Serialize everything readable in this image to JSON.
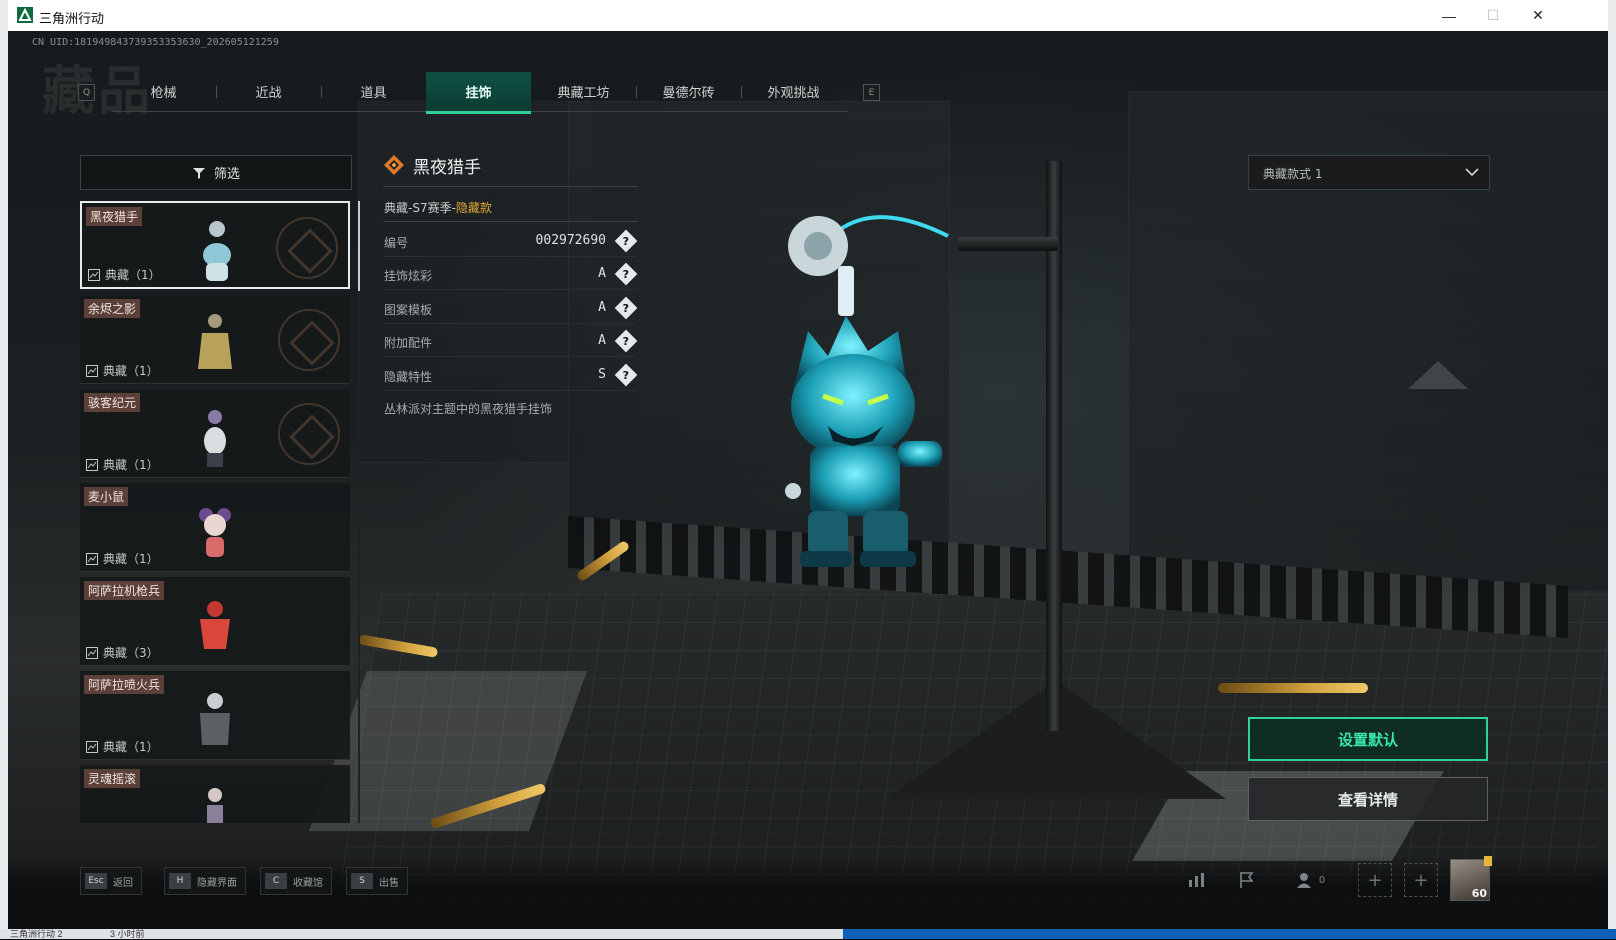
{
  "window": {
    "title": "三角洲行动",
    "controls": {
      "minimize": "—",
      "maximize": "☐",
      "close": "✕"
    }
  },
  "uid_text": "CN UID:18194984373935335363​0_202605121259",
  "bg_heading": "藏品",
  "tabs": {
    "left_key": "Q",
    "right_key": "E",
    "items": [
      {
        "label": "枪械",
        "active": false
      },
      {
        "label": "近战",
        "active": false
      },
      {
        "label": "道具",
        "active": false
      },
      {
        "label": "挂饰",
        "active": true
      },
      {
        "label": "典藏工坊",
        "active": false
      },
      {
        "label": "曼德尔砖",
        "active": false
      },
      {
        "label": "外观挑战",
        "active": false
      }
    ]
  },
  "filter": {
    "label": "筛选",
    "icon": "filter-icon"
  },
  "list": {
    "items": [
      {
        "name": "黑夜猎手",
        "badge": "典藏（1）",
        "selected": true
      },
      {
        "name": "余烬之影",
        "badge": "典藏（1）",
        "selected": false
      },
      {
        "name": "骇客纪元",
        "badge": "典藏（1）",
        "selected": false
      },
      {
        "name": "麦小鼠",
        "badge": "典藏（1）",
        "selected": false
      },
      {
        "name": "阿萨拉机枪兵",
        "badge": "典藏（3）",
        "selected": false
      },
      {
        "name": "阿萨拉喷火兵",
        "badge": "典藏（1）",
        "selected": false
      },
      {
        "name": "灵魂摇滚",
        "badge": "",
        "selected": false
      }
    ]
  },
  "detail": {
    "title": "黑夜猎手",
    "subtitle_prefix": "典藏-S7赛季-",
    "subtitle_tag": "隐藏款",
    "attributes": [
      {
        "key": "编号",
        "value": "002972690"
      },
      {
        "key": "挂饰炫彩",
        "value": "A"
      },
      {
        "key": "图案模板",
        "value": "A"
      },
      {
        "key": "附加配件",
        "value": "A"
      },
      {
        "key": "隐藏特性",
        "value": "S"
      }
    ],
    "help_glyph": "?",
    "description": "丛林派对主题中的黑夜猎手挂饰"
  },
  "style_select": {
    "value": "典藏款式 1"
  },
  "buttons": {
    "set_default": "设置默认",
    "view_details": "查看详情"
  },
  "hotkeys": [
    {
      "key": "Esc",
      "label": "返回"
    },
    {
      "key": "H",
      "label": "隐藏界面"
    },
    {
      "key": "C",
      "label": "收藏馆"
    },
    {
      "key": "S",
      "label": "出售"
    }
  ],
  "bottom_right": {
    "friends_count": "0",
    "level": "60"
  },
  "taskbar": {
    "left_text": "三角洲行动 2",
    "mid_text": "3 小时前"
  },
  "colors": {
    "accent": "#2fd39a",
    "hidden_tag": "#e0a83a",
    "tag_bg": "#5a4038"
  }
}
